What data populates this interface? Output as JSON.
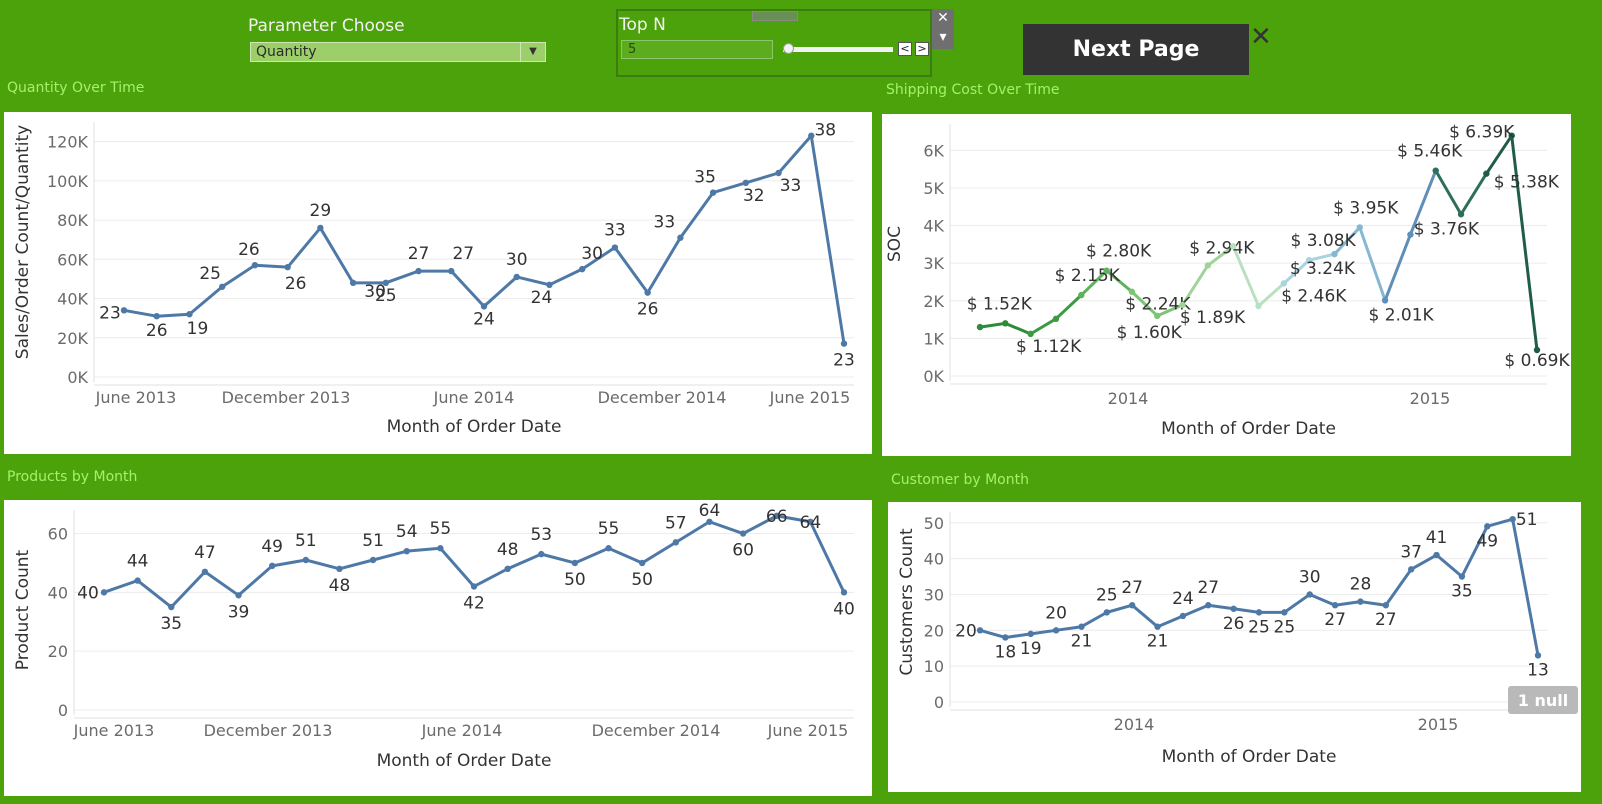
{
  "controls": {
    "parameter_title": "Parameter Choose",
    "parameter_value": "Quantity",
    "topn_title": "Top N",
    "topn_value": "5",
    "next_page_label": "Next Page"
  },
  "colors": {
    "background": "#4ca20a",
    "line": "#4e79a7",
    "title": "#a6f06c"
  },
  "chart_data": [
    {
      "id": "qty",
      "type": "line",
      "title": "Quantity Over Time",
      "xlabel": "Month of Order Date",
      "ylabel": "Sales/Order Count/Quantity",
      "x": [
        "2013-04",
        "2013-05",
        "2013-06",
        "2013-07",
        "2013-08",
        "2013-09",
        "2013-10",
        "2013-11",
        "2013-12",
        "2014-01",
        "2014-02",
        "2014-03",
        "2014-04",
        "2014-05",
        "2014-06",
        "2014-07",
        "2014-08",
        "2014-09",
        "2014-10",
        "2014-11",
        "2014-12",
        "2015-01",
        "2015-02",
        "2015-03",
        "2015-04",
        "2015-05",
        "2015-06"
      ],
      "values": [
        34000,
        31000,
        32000,
        46000,
        57000,
        56000,
        76000,
        48000,
        48000,
        54000,
        54000,
        36000,
        51000,
        47000,
        55000,
        66000,
        43000,
        71000,
        94000,
        99000,
        104000,
        123000,
        17000
      ],
      "values_note": "",
      "labels": [
        "23",
        "26",
        "19",
        "25",
        "26",
        "26",
        "29",
        "30",
        "25",
        "27",
        "27",
        "24",
        "30",
        "24",
        "30",
        "33",
        "26",
        "33",
        "35",
        "32",
        "33",
        "38",
        "23"
      ],
      "x_dates": [
        "2013-04",
        "2013-05",
        "2013-06",
        "2013-07",
        "2013-08",
        "2013-09",
        "2013-10",
        "2013-11",
        "2013-12",
        "2014-01",
        "2014-02",
        "2014-03",
        "2014-04",
        "2014-05",
        "2014-06",
        "2014-07",
        "2014-08",
        "2014-09",
        "2014-10",
        "2014-11",
        "2014-12",
        "2015-01",
        "2015-02"
      ],
      "ylim": [
        0,
        130000
      ],
      "yticks": [
        "0K",
        "20K",
        "40K",
        "60K",
        "80K",
        "100K",
        "120K"
      ],
      "xticks": [
        "June 2013",
        "December 2013",
        "June 2014",
        "December 2014",
        "June 2015"
      ],
      "grid": true
    },
    {
      "id": "ship",
      "type": "line",
      "title": "Shipping Cost Over Time",
      "xlabel": "Month of Order Date",
      "ylabel": "SOC",
      "x_dates": [
        "2013-06",
        "2013-07",
        "2013-08",
        "2013-09",
        "2013-10",
        "2013-11",
        "2013-12",
        "2014-01",
        "2014-02",
        "2014-03",
        "2014-04",
        "2014-05",
        "2014-06",
        "2014-07",
        "2014-08",
        "2014-09",
        "2014-10",
        "2014-11",
        "2014-12",
        "2015-01",
        "2015-02",
        "2015-03",
        "2015-04",
        "2015-05",
        "2015-06"
      ],
      "values": [
        1300,
        1400,
        1120,
        1520,
        2150,
        2800,
        2240,
        1600,
        1890,
        2940,
        3450,
        1860,
        2460,
        3080,
        3240,
        3950,
        2010,
        3760,
        5460,
        4300,
        5380,
        6390,
        690
      ],
      "labels": [
        "",
        "$ 1.52K",
        "$ 1.12K",
        "",
        "$ 2.15K",
        "$ 2.80K",
        "$ 2.24K",
        "$ 1.60K",
        "$ 1.89K",
        "$ 2.94K",
        "",
        "",
        "$ 2.46K",
        "$ 3.08K",
        "$ 3.24K",
        "$ 3.95K",
        "$ 2.01K",
        "$ 3.76K",
        "$ 5.46K",
        "",
        "$ 5.38K",
        "$ 6.39K",
        "$ 0.69K"
      ],
      "ylim": [
        0,
        6700
      ],
      "yticks": [
        "0K",
        "1K",
        "2K",
        "3K",
        "4K",
        "5K",
        "6K"
      ],
      "xticks": [
        "2014",
        "2015"
      ],
      "grid": true
    },
    {
      "id": "prod",
      "type": "line",
      "title": "Products by Month",
      "xlabel": "Month of Order Date",
      "ylabel": "Product Count",
      "values": [
        40,
        44,
        35,
        47,
        39,
        49,
        51,
        48,
        51,
        54,
        55,
        42,
        48,
        53,
        50,
        55,
        50,
        57,
        64,
        60,
        66,
        64,
        40
      ],
      "labels": [
        "40",
        "44",
        "35",
        "47",
        "39",
        "49",
        "51",
        "48",
        "51",
        "54",
        "55",
        "42",
        "48",
        "53",
        "50",
        "55",
        "50",
        "57",
        "64",
        "60",
        "66",
        "64",
        "40"
      ],
      "ylim": [
        0,
        68
      ],
      "yticks": [
        "0",
        "20",
        "40",
        "60"
      ],
      "xticks": [
        "June 2013",
        "December 2013",
        "June 2014",
        "December 2014",
        "June 2015"
      ],
      "grid": true
    },
    {
      "id": "cust",
      "type": "line",
      "title": "Customer by Month",
      "xlabel": "Month of Order Date",
      "ylabel": "Customers Count",
      "values": [
        20,
        18,
        19,
        20,
        21,
        25,
        27,
        21,
        24,
        27,
        26,
        25,
        25,
        30,
        27,
        28,
        27,
        37,
        41,
        35,
        49,
        51,
        13
      ],
      "labels": [
        "20",
        "18",
        "19",
        "20",
        "21",
        "25",
        "27",
        "21",
        "24",
        "27",
        "26",
        "25",
        "25",
        "30",
        "27",
        "28",
        "27",
        "37",
        "41",
        "35",
        "49",
        "51",
        "13"
      ],
      "ylim": [
        0,
        53
      ],
      "yticks": [
        "0",
        "10",
        "20",
        "30",
        "40",
        "50"
      ],
      "xticks": [
        "2014",
        "2015"
      ],
      "null_badge": "1 null",
      "grid": true
    }
  ]
}
